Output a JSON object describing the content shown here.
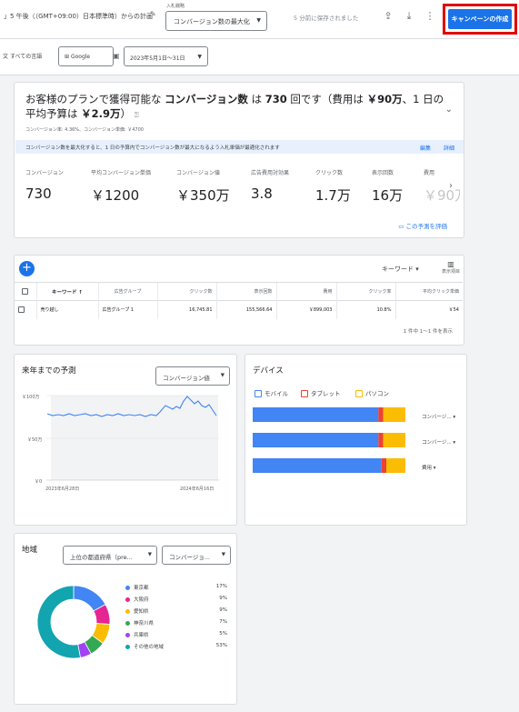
{
  "toolbar": {
    "date_text": "」5 午後（（GMT+09:00）日本標準時）からの計画",
    "strategy_label": "入札戦略",
    "strategy_value": "コンバージョン数の最大化",
    "saved_text": "5 分前に保存されました",
    "create_button": "キャンペーンの作成",
    "accent_color": "#1a73e8",
    "highlight_color": "#e00000"
  },
  "filters": {
    "language": "すべての言語",
    "network": "Google",
    "date_range": "2023年5月1日〜31日"
  },
  "summary": {
    "title_prefix": "お客様のプランで獲得可能な",
    "title_metric": "コンバージョン数",
    "title_mid": "は",
    "title_count": "730",
    "title_after_count": "回です（費用は",
    "title_cost": "￥90万",
    "title_daily": "、1 日の平均予算は",
    "title_budget": "￥2.9万",
    "title_end": "）",
    "sub": "コンバージョン率: 4.36%、コンバージョン単価: ￥4700",
    "banner": "コンバージョン数を最大化すると、1 日の予算内でコンバージョン数が最大になるよう入札単価が最適化されます",
    "banner_edit": "編集",
    "banner_details": "詳細",
    "metrics": [
      {
        "label": "コンバージョン",
        "value": "730"
      },
      {
        "label": "平均コンバージョン単価",
        "value": "￥1200"
      },
      {
        "label": "コンバージョン値",
        "value": "￥350万"
      },
      {
        "label": "広告費用対効果",
        "value": "3.8"
      },
      {
        "label": "クリック数",
        "value": "1.7万"
      },
      {
        "label": "表示回数",
        "value": "16万"
      },
      {
        "label": "費用",
        "value": "￥90万"
      }
    ],
    "rate_link": "この予測を評価"
  },
  "keywords": {
    "dropdown": "キーワード",
    "columns_button": "表示項目",
    "headers": [
      "キーワード",
      "広告グループ",
      "クリック数",
      "表示回数",
      "費用",
      "クリック率",
      "平均クリック単価"
    ],
    "rows": [
      [
        "売り越し",
        "広告グループ 1",
        "16,745.81",
        "155,566.64",
        "￥899,003",
        "10.8%",
        "￥54"
      ]
    ],
    "pager": "1 件中 1〜1 件を表示"
  },
  "forecast": {
    "title": "来年までの予測",
    "select": "コンバージョン値",
    "y_ticks": [
      "￥100万",
      "￥50万",
      "￥0"
    ],
    "x_ticks": [
      "2023年6月28日",
      "2024年6月16日"
    ]
  },
  "devices": {
    "title": "デバイス",
    "legend": [
      {
        "name": "モバイル",
        "color": "#4285f4"
      },
      {
        "name": "タブレット",
        "color": "#ea4335"
      },
      {
        "name": "パソコン",
        "color": "#fbbc04"
      }
    ],
    "rows": [
      {
        "metric": "コンバージ...",
        "mobile": 0.79,
        "tablet": 0.03,
        "desktop": 0.14
      },
      {
        "metric": "コンバージ...",
        "mobile": 0.79,
        "tablet": 0.03,
        "desktop": 0.14
      },
      {
        "metric": "費用",
        "mobile": 0.81,
        "tablet": 0.03,
        "desktop": 0.12
      }
    ]
  },
  "regions": {
    "title": "地域",
    "select_1": "上位の都道府県（pre...",
    "select_2": "コンバージョ...",
    "items": [
      {
        "name": "東京都",
        "pct": "17%",
        "value": 17,
        "color": "#4285f4"
      },
      {
        "name": "大阪府",
        "pct": "9%",
        "value": 9,
        "color": "#e52592"
      },
      {
        "name": "愛知県",
        "pct": "9%",
        "value": 9,
        "color": "#fbbc04"
      },
      {
        "name": "神奈川県",
        "pct": "7%",
        "value": 7,
        "color": "#34a853"
      },
      {
        "name": "兵庫県",
        "pct": "5%",
        "value": 5,
        "color": "#a142f4"
      },
      {
        "name": "その他の地域",
        "pct": "53%",
        "value": 53,
        "color": "#12a4af"
      }
    ]
  }
}
